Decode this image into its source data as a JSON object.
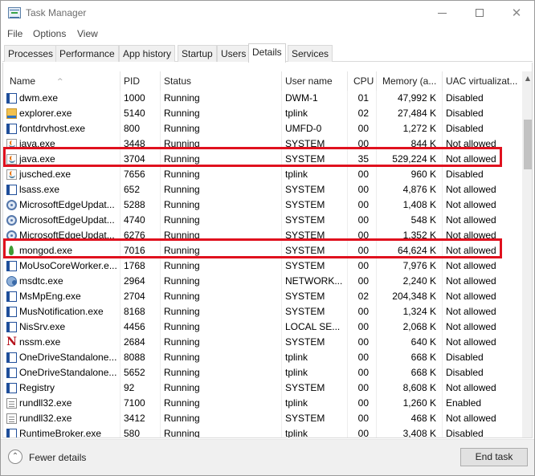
{
  "window": {
    "title": "Task Manager",
    "icon": "task-manager-icon",
    "controls": {
      "minimize": "minimize-icon",
      "maximize": "maximize-icon",
      "close": "✕"
    }
  },
  "menu": [
    "File",
    "Options",
    "View"
  ],
  "tabs": [
    "Processes",
    "Performance",
    "App history",
    "Startup",
    "Users",
    "Details",
    "Services"
  ],
  "active_tab": "Details",
  "columns": {
    "name": "Name",
    "pid": "PID",
    "status": "Status",
    "user": "User name",
    "cpu": "CPU",
    "memory": "Memory (a...",
    "uac": "UAC virtualizat..."
  },
  "sort_indicator": "^",
  "processes": [
    {
      "icon": "window",
      "name": "dwm.exe",
      "pid": "1000",
      "status": "Running",
      "user": "DWM-1",
      "cpu": "01",
      "memory": "47,992 K",
      "uac": "Disabled"
    },
    {
      "icon": "folder",
      "name": "explorer.exe",
      "pid": "5140",
      "status": "Running",
      "user": "tplink",
      "cpu": "02",
      "memory": "27,484 K",
      "uac": "Disabled"
    },
    {
      "icon": "window",
      "name": "fontdrvhost.exe",
      "pid": "800",
      "status": "Running",
      "user": "UMFD-0",
      "cpu": "00",
      "memory": "1,272 K",
      "uac": "Disabled"
    },
    {
      "icon": "java",
      "name": "java.exe",
      "pid": "3448",
      "status": "Running",
      "user": "SYSTEM",
      "cpu": "00",
      "memory": "844 K",
      "uac": "Not allowed"
    },
    {
      "icon": "java",
      "name": "java.exe",
      "pid": "3704",
      "status": "Running",
      "user": "SYSTEM",
      "cpu": "35",
      "memory": "529,224 K",
      "uac": "Not allowed"
    },
    {
      "icon": "java",
      "name": "jusched.exe",
      "pid": "7656",
      "status": "Running",
      "user": "tplink",
      "cpu": "00",
      "memory": "960 K",
      "uac": "Disabled"
    },
    {
      "icon": "window",
      "name": "lsass.exe",
      "pid": "652",
      "status": "Running",
      "user": "SYSTEM",
      "cpu": "00",
      "memory": "4,876 K",
      "uac": "Not allowed"
    },
    {
      "icon": "gear",
      "name": "MicrosoftEdgeUpdat...",
      "pid": "5288",
      "status": "Running",
      "user": "SYSTEM",
      "cpu": "00",
      "memory": "1,408 K",
      "uac": "Not allowed"
    },
    {
      "icon": "gear",
      "name": "MicrosoftEdgeUpdat...",
      "pid": "4740",
      "status": "Running",
      "user": "SYSTEM",
      "cpu": "00",
      "memory": "548 K",
      "uac": "Not allowed"
    },
    {
      "icon": "gear",
      "name": "MicrosoftEdgeUpdat...",
      "pid": "6276",
      "status": "Running",
      "user": "SYSTEM",
      "cpu": "00",
      "memory": "1,352 K",
      "uac": "Not allowed"
    },
    {
      "icon": "leaf",
      "name": "mongod.exe",
      "pid": "7016",
      "status": "Running",
      "user": "SYSTEM",
      "cpu": "00",
      "memory": "64,624 K",
      "uac": "Not allowed"
    },
    {
      "icon": "window",
      "name": "MoUsoCoreWorker.e...",
      "pid": "1768",
      "status": "Running",
      "user": "SYSTEM",
      "cpu": "00",
      "memory": "7,976 K",
      "uac": "Not allowed"
    },
    {
      "icon": "msdtc",
      "name": "msdtc.exe",
      "pid": "2964",
      "status": "Running",
      "user": "NETWORK...",
      "cpu": "00",
      "memory": "2,240 K",
      "uac": "Not allowed"
    },
    {
      "icon": "window",
      "name": "MsMpEng.exe",
      "pid": "2704",
      "status": "Running",
      "user": "SYSTEM",
      "cpu": "02",
      "memory": "204,348 K",
      "uac": "Not allowed"
    },
    {
      "icon": "window",
      "name": "MusNotification.exe",
      "pid": "8168",
      "status": "Running",
      "user": "SYSTEM",
      "cpu": "00",
      "memory": "1,324 K",
      "uac": "Not allowed"
    },
    {
      "icon": "window",
      "name": "NisSrv.exe",
      "pid": "4456",
      "status": "Running",
      "user": "LOCAL SE...",
      "cpu": "00",
      "memory": "2,068 K",
      "uac": "Not allowed"
    },
    {
      "icon": "n",
      "name": "nssm.exe",
      "pid": "2684",
      "status": "Running",
      "user": "SYSTEM",
      "cpu": "00",
      "memory": "640 K",
      "uac": "Not allowed"
    },
    {
      "icon": "window",
      "name": "OneDriveStandalone...",
      "pid": "8088",
      "status": "Running",
      "user": "tplink",
      "cpu": "00",
      "memory": "668 K",
      "uac": "Disabled"
    },
    {
      "icon": "window",
      "name": "OneDriveStandalone...",
      "pid": "5652",
      "status": "Running",
      "user": "tplink",
      "cpu": "00",
      "memory": "668 K",
      "uac": "Disabled"
    },
    {
      "icon": "window",
      "name": "Registry",
      "pid": "92",
      "status": "Running",
      "user": "SYSTEM",
      "cpu": "00",
      "memory": "8,608 K",
      "uac": "Not allowed"
    },
    {
      "icon": "dll",
      "name": "rundll32.exe",
      "pid": "7100",
      "status": "Running",
      "user": "tplink",
      "cpu": "00",
      "memory": "1,260 K",
      "uac": "Enabled"
    },
    {
      "icon": "dll",
      "name": "rundll32.exe",
      "pid": "3412",
      "status": "Running",
      "user": "SYSTEM",
      "cpu": "00",
      "memory": "468 K",
      "uac": "Not allowed"
    },
    {
      "icon": "window",
      "name": "RuntimeBroker.exe",
      "pid": "580",
      "status": "Running",
      "user": "tplink",
      "cpu": "00",
      "memory": "3,408 K",
      "uac": "Disabled"
    }
  ],
  "highlighted_pids": [
    "3704",
    "7016"
  ],
  "highlight_color": "#e0111e",
  "footer": {
    "fewer_details": "Fewer details",
    "fewer_icon": "⌃",
    "end_task": "End task"
  }
}
